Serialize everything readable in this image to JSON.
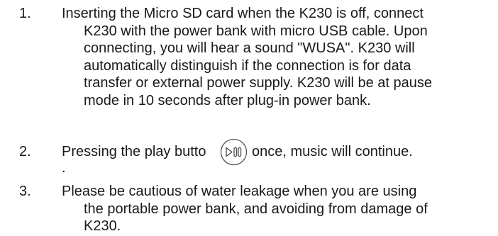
{
  "steps": [
    {
      "number": "1.",
      "lines": [
        "Inserting the Micro SD card when the K230 is off, connect",
        "K230 with the power bank with micro USB cable. Upon",
        "connecting, you will hear a sound \"WUSA\". K230 will",
        "automatically distinguish if the connection is for data",
        "transfer or external power supply. K230 will be at pause",
        "mode in 10 seconds after plug-in power bank."
      ]
    },
    {
      "number": "2.",
      "before_icon": "Pressing the play butto",
      "icon": "play-pause-button-icon",
      "after_icon": "once, music will continue.",
      "trailing": "."
    },
    {
      "number": "3.",
      "lines": [
        "Please be cautious of water leakage when you are using",
        "the portable power bank, and avoiding from damage of",
        "K230."
      ]
    }
  ]
}
